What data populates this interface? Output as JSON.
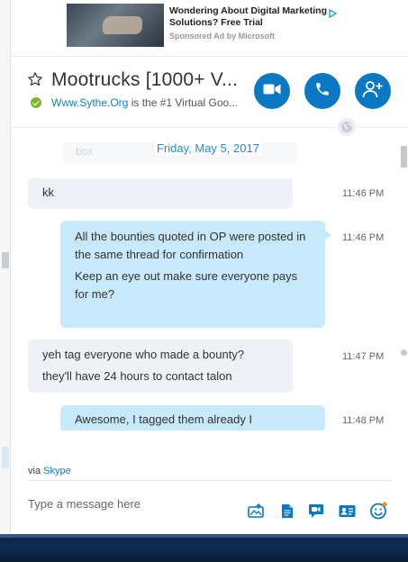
{
  "ad": {
    "title": "Wondering About Digital Marketing Solutions? Free Trial",
    "sponsor": "Sponsored Ad by Microsoft",
    "choices_icon": "play-triangle-icon"
  },
  "header": {
    "title": "Mootrucks [1000+ V...",
    "mood_link": "Www.Sythe.Org",
    "mood_text": " is the #1 Virtual Goo...",
    "favorite_icon": "star-outline-icon",
    "presence": "online",
    "actions": [
      {
        "name": "video-call",
        "icon": "video-camera-icon"
      },
      {
        "name": "audio-call",
        "icon": "phone-icon"
      },
      {
        "name": "add-people",
        "icon": "add-person-icon"
      }
    ]
  },
  "chat": {
    "date_separator": "Friday, May 5, 2017",
    "ghost_text": "box",
    "messages": [
      {
        "direction": "incoming",
        "lines": [
          "kk"
        ],
        "time": "11:46 PM"
      },
      {
        "direction": "outgoing",
        "lines": [
          "All the bounties quoted in OP were posted in the same thread for confirmation",
          "Keep an eye out make sure everyone pays for me?"
        ],
        "time": "11:46 PM"
      },
      {
        "direction": "incoming",
        "lines": [
          "yeh tag everyone who made a bounty?",
          "they'll have 24 hours to contact talon"
        ],
        "time": "11:47 PM"
      },
      {
        "direction": "outgoing",
        "lines": [
          "Awesome, I tagged them already I"
        ],
        "time": "11:48 PM"
      }
    ]
  },
  "footer": {
    "via_prefix": "via ",
    "via_link": "Skype",
    "compose_placeholder": "Type a message here",
    "tools": [
      "send-file-icon",
      "send-document-icon",
      "video-message-icon",
      "send-contact-icon",
      "emoticon-icon"
    ]
  },
  "colors": {
    "accent": "#0a78c2",
    "link": "#0d80c9",
    "outgoing_bubble": "#c7e9fb",
    "incoming_bubble": "#eef1f5",
    "presence_online": "#7cb82f",
    "taskbar": "#102b52"
  }
}
